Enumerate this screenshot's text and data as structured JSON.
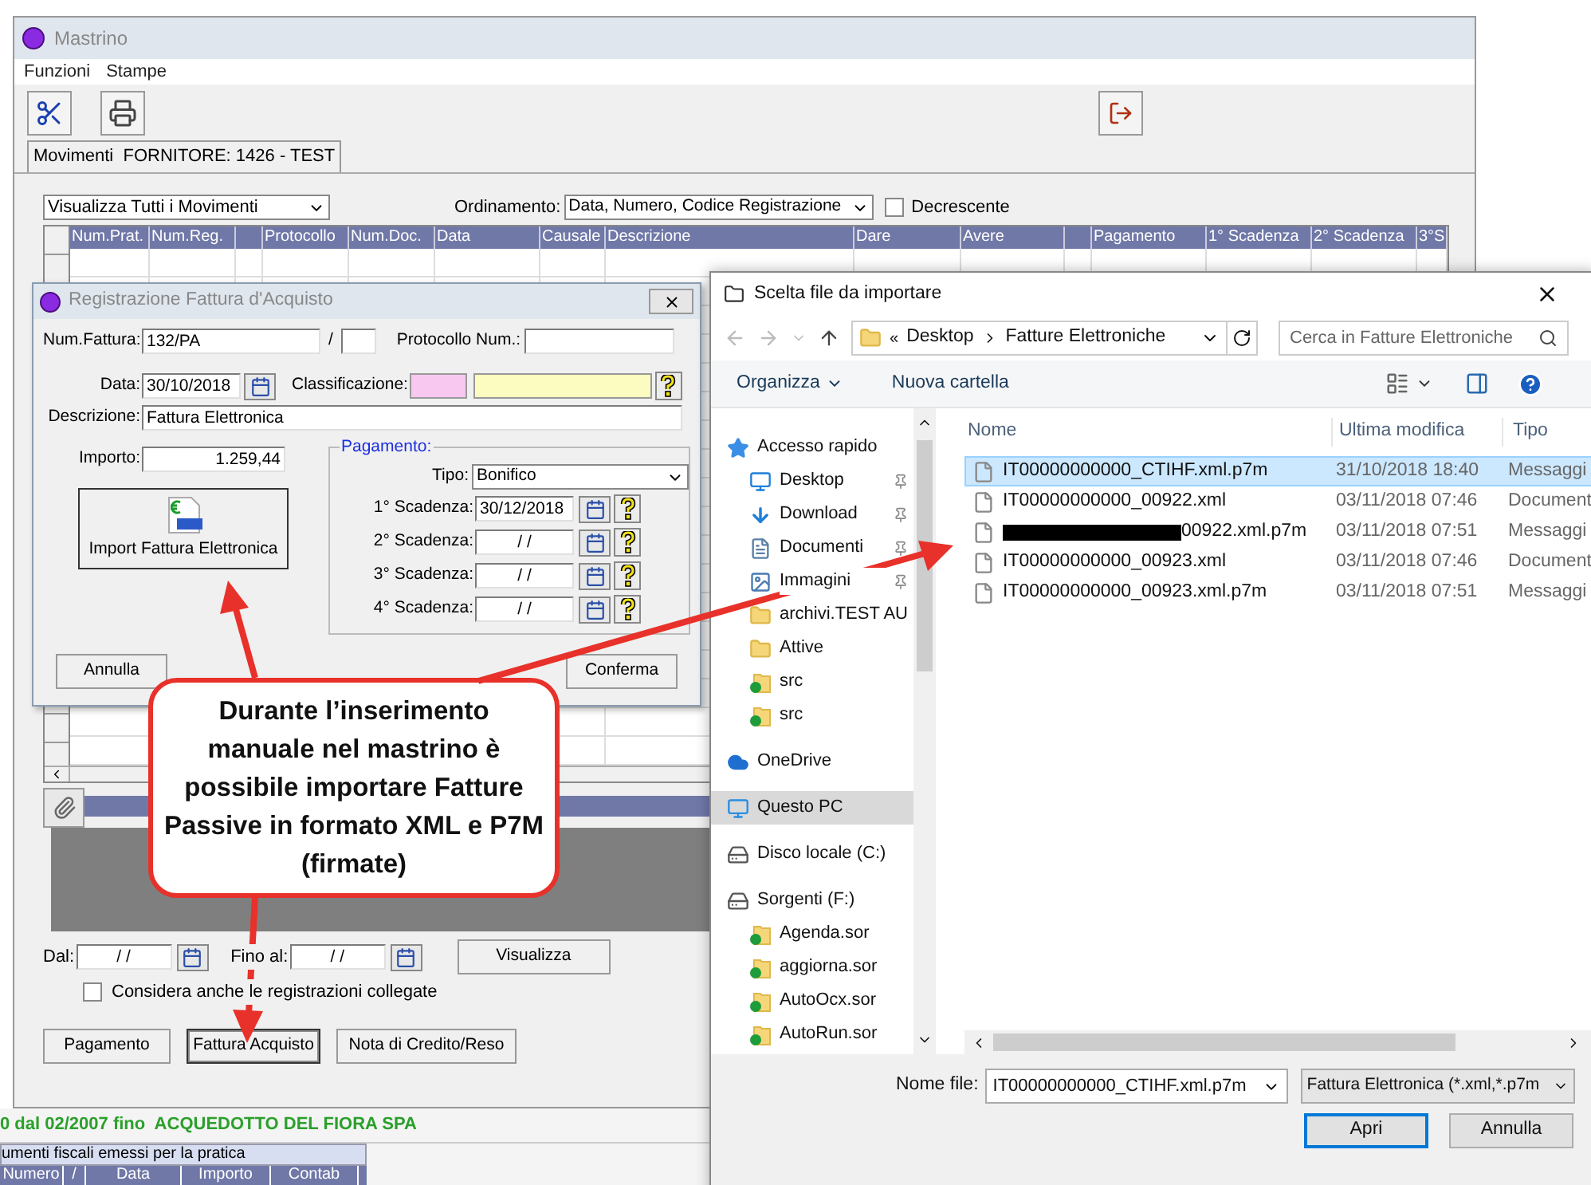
{
  "mastrino": {
    "title": "Mastrino",
    "menu": [
      "Funzioni",
      "Stampe"
    ],
    "tab": {
      "label": "Movimenti  FORNITORE: 1426 - TEST",
      "selected": true
    },
    "filter": "Visualizza Tutti i Movimenti",
    "ordering_label": "Ordinamento:",
    "ordering": "Data, Numero, Codice Registrazione",
    "descending": {
      "label": "Decrescente",
      "checked": false
    },
    "columns": [
      {
        "kind": "text",
        "label": "Num.Prat."
      },
      {
        "kind": "text",
        "label": "Num.Reg."
      },
      {
        "kind": "blank"
      },
      {
        "kind": "text",
        "label": "Protocollo"
      },
      {
        "kind": "text",
        "label": "Num.Doc."
      },
      {
        "kind": "text",
        "label": "Data"
      },
      {
        "kind": "text",
        "label": "Causale"
      },
      {
        "kind": "text",
        "label": "Descrizione"
      },
      {
        "kind": "text",
        "label": "Dare"
      },
      {
        "kind": "text",
        "label": "Avere"
      },
      {
        "kind": "blank"
      },
      {
        "kind": "text",
        "label": "Pagamento"
      },
      {
        "kind": "text",
        "label": "1° Scadenza"
      },
      {
        "kind": "text",
        "label": "2° Scadenza"
      },
      {
        "kind": "text",
        "label": "3°S"
      }
    ],
    "from_label": "Dal:",
    "from_value": "/ /",
    "to_label": "Fino al:",
    "to_value": "/ /",
    "show_button": "Visualizza",
    "linked": {
      "label": "Considera anche le registrazioni collegate",
      "checked": false
    },
    "buttons": [
      {
        "label": "Pagamento",
        "focused": false
      },
      {
        "label": "Fattura Acquisto",
        "focused": true
      },
      {
        "label": "Nota di Credito/Reso",
        "focused": false
      }
    ]
  },
  "background": {
    "green_text": "0 dal 02/2007 fino  ACQUEDOTTO DEL FIORA SPA",
    "docs_title": "umenti fiscali emessi per la pratica",
    "docs_columns": [
      "Numero",
      "/",
      "Data",
      "Importo",
      "Contab"
    ]
  },
  "invoice_dialog": {
    "title": "Registrazione Fattura d'Acquisto",
    "number_label": "Num.Fattura:",
    "number": "132/PA",
    "slash": "/",
    "protocol_label": "Protocollo Num.:",
    "date_label": "Data:",
    "date": "30/10/2018",
    "class_label": "Classificazione:",
    "desc_label": "Descrizione:",
    "description": "Fattura Elettronica",
    "amount_label": "Importo:",
    "amount": "1.259,44",
    "import_button": "Import Fattura Elettronica",
    "payment": {
      "legend": "Pagamento:",
      "type_label": "Tipo:",
      "type": "Bonifico",
      "due": [
        {
          "label": "1° Scadenza:",
          "value": "30/12/2018"
        },
        {
          "label": "2° Scadenza:",
          "value": "/ /"
        },
        {
          "label": "3° Scadenza:",
          "value": "/ /"
        },
        {
          "label": "4° Scadenza:",
          "value": "/ /"
        }
      ]
    },
    "cancel": "Annulla",
    "confirm": "Conferma"
  },
  "callout": "Durante l’inserimento manuale nel mastrino è possibile importare Fatture Passive in formato XML e P7M (firmate)",
  "file_dialog": {
    "title": "Scelta file da importare",
    "path": [
      "Desktop",
      "Fatture Elettroniche"
    ],
    "path_prefix": "«",
    "search": {
      "placeholder": "Cerca in Fatture Elettroniche"
    },
    "organize": "Organizza",
    "new_folder": "Nuova cartella",
    "sidebar": [
      {
        "label": "Accesso rapido",
        "kind": "quick",
        "selected": false,
        "children": [
          {
            "label": "Desktop",
            "kind": "desktop",
            "pinned": true,
            "selected": false
          },
          {
            "label": "Download",
            "kind": "download",
            "pinned": true,
            "selected": false
          },
          {
            "label": "Documenti",
            "kind": "documents",
            "pinned": true,
            "selected": false
          },
          {
            "label": "Immagini",
            "kind": "pictures",
            "pinned": true,
            "selected": false
          },
          {
            "label": "archivi.TEST AU",
            "kind": "folder",
            "pinned": false,
            "selected": false
          },
          {
            "label": "Attive",
            "kind": "folder",
            "pinned": false,
            "selected": false
          },
          {
            "label": "src",
            "kind": "synced",
            "pinned": false,
            "selected": false
          },
          {
            "label": "src",
            "kind": "synced",
            "pinned": false,
            "selected": false
          }
        ]
      },
      {
        "label": "OneDrive",
        "kind": "cloud",
        "selected": false
      },
      {
        "label": "Questo PC",
        "kind": "pc",
        "selected": true
      },
      {
        "label": "Disco locale (C:)",
        "kind": "disk",
        "selected": false
      },
      {
        "label": "Sorgenti (F:)",
        "kind": "drive",
        "selected": false,
        "children": [
          {
            "label": "Agenda.sor",
            "kind": "synced",
            "pinned": false,
            "selected": false
          },
          {
            "label": "aggiorna.sor",
            "kind": "synced",
            "pinned": false,
            "selected": false
          },
          {
            "label": "AutoOcx.sor",
            "kind": "synced",
            "pinned": false,
            "selected": false
          },
          {
            "label": "AutoRun.sor",
            "kind": "synced",
            "pinned": false,
            "selected": false
          }
        ]
      }
    ],
    "columns": [
      "Nome",
      "Ultima modifica",
      "Tipo"
    ],
    "files": [
      {
        "name": "IT00000000000_CTIHF.xml.p7m",
        "modified": "31/10/2018 18:40",
        "type": "Messaggi",
        "selected": true,
        "redacted": false
      },
      {
        "name": "IT00000000000_00922.xml",
        "modified": "03/11/2018 07:46",
        "type": "Document",
        "selected": false,
        "redacted": false
      },
      {
        "name": "00922.xml.p7m",
        "modified": "03/11/2018 07:51",
        "type": "Messaggi",
        "selected": false,
        "redacted": true
      },
      {
        "name": "IT00000000000_00923.xml",
        "modified": "03/11/2018 07:46",
        "type": "Document",
        "selected": false,
        "redacted": false
      },
      {
        "name": "IT00000000000_00923.xml.p7m",
        "modified": "03/11/2018 07:51",
        "type": "Messaggi",
        "selected": false,
        "redacted": false
      }
    ],
    "filename_label": "Nome file:",
    "filename": "IT00000000000_CTIHF.xml.p7m",
    "filter": "Fattura Elettronica (*.xml,*.p7m",
    "open": "Apri",
    "cancel": "Annulla"
  }
}
